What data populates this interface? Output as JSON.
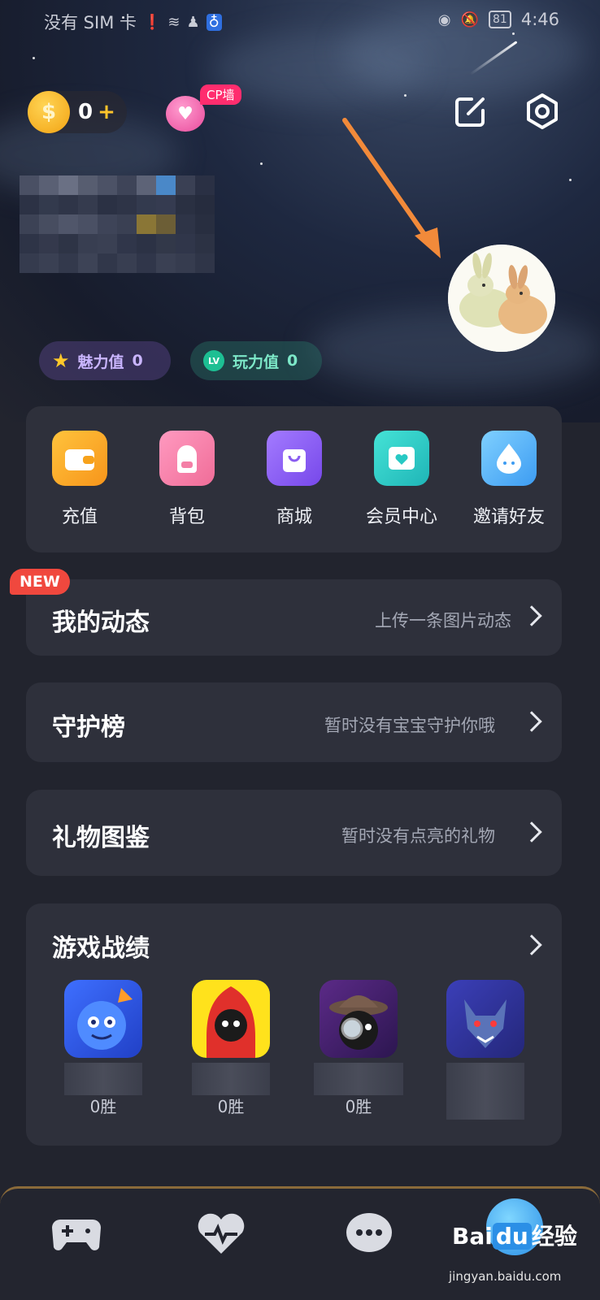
{
  "status_bar": {
    "carrier": "没有 SIM 卡",
    "battery": "81",
    "time": "4:46"
  },
  "header": {
    "coin_count": "0",
    "coin_plus": "+",
    "cp_badge": "CP墙",
    "icons": [
      "edit-icon",
      "settings-hex-icon"
    ]
  },
  "profile": {
    "chips": [
      {
        "label": "魅力值",
        "value": "0",
        "icon": "star-icon"
      },
      {
        "label": "玩力值",
        "value": "0",
        "icon": "lv-icon"
      }
    ]
  },
  "quick_actions": [
    {
      "label": "充值",
      "icon": "wallet-icon",
      "color": "#f7a21b"
    },
    {
      "label": "背包",
      "icon": "backpack-icon",
      "color": "#f47fa6"
    },
    {
      "label": "商城",
      "icon": "shopping-bag-icon",
      "color": "#8a5cf0"
    },
    {
      "label": "会员中心",
      "icon": "member-card-icon",
      "color": "#27c9c4"
    },
    {
      "label": "邀请好友",
      "icon": "drop-face-icon",
      "color": "#5ab6f5"
    }
  ],
  "rows": [
    {
      "title": "我的动态",
      "subtitle": "上传一条图片动态",
      "badge": "NEW"
    },
    {
      "title": "守护榜",
      "subtitle": "暂时没有宝宝守护你哦"
    },
    {
      "title": "礼物图鉴",
      "subtitle": "暂时没有点亮的礼物"
    }
  ],
  "games": {
    "title": "游戏战绩",
    "items": [
      {
        "wins": "0胜",
        "icon": "blue-monster-game-icon"
      },
      {
        "wins": "0胜",
        "icon": "red-hood-game-icon"
      },
      {
        "wins": "0胜",
        "icon": "detective-game-icon"
      },
      {
        "wins": "",
        "icon": "werewolf-game-icon"
      }
    ]
  },
  "tabbar": {
    "tabs": [
      "gamepad-icon",
      "heartbeat-icon",
      "chat-bubble-icon",
      "paw-icon"
    ]
  },
  "watermark": {
    "brand": "Bai",
    "brand_suffix": "经验",
    "url": "jingyan.baidu.com"
  }
}
